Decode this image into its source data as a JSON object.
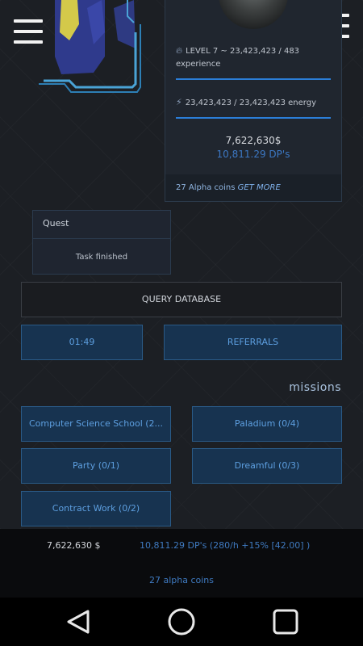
{
  "header": {
    "menu_left_icon": "hamburger-menu-icon",
    "menu_right_icon": "hamburger-menu-icon"
  },
  "stats": {
    "level_text": "LEVEL 7 ~ 23,423,423 / 483",
    "experience_label": "experience",
    "level_icon": "flame-icon",
    "energy_icon": "lightning-icon",
    "energy_text": "23,423,423 / 23,423,423 energy",
    "money": "7,622,630$",
    "dp": "10,811.29 DP's",
    "coins_text": "27 Alpha coins",
    "get_more": "GET MORE",
    "accent_color": "#2b7ed8"
  },
  "quest": {
    "title": "Quest",
    "status": "Task finished"
  },
  "buttons": {
    "query_database": "QUERY DATABASE",
    "timer": "01:49",
    "referrals": "REFERRALS"
  },
  "missions": {
    "label": "missions",
    "items": [
      {
        "label": "Computer Science School (2..."
      },
      {
        "label": "Paladium (0/4)"
      },
      {
        "label": "Party (0/1)"
      },
      {
        "label": "Dreamful (0/3)"
      },
      {
        "label": "Contract Work (0/2)"
      }
    ]
  },
  "footer": {
    "money": "7,622,630 $",
    "dp_rate": "10,811.29 DP's (280/h +15% [42.00] )",
    "coins": "27 alpha coins"
  },
  "navbar": {
    "back_icon": "back-triangle-icon",
    "home_icon": "home-circle-icon",
    "recents_icon": "recents-square-icon"
  }
}
